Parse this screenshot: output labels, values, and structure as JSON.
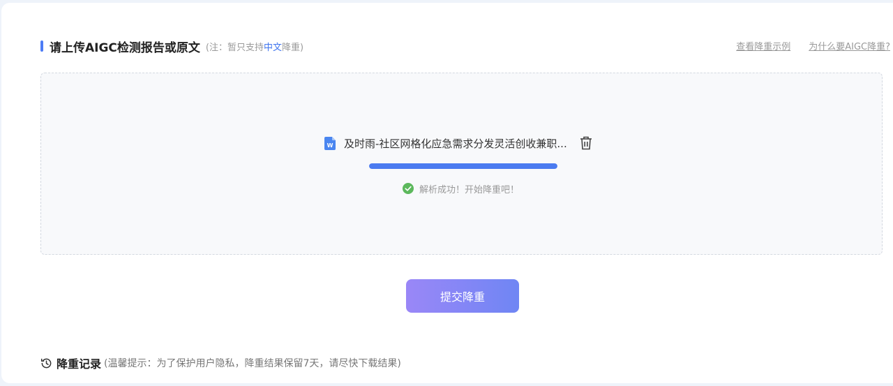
{
  "upload": {
    "title": "请上传AIGC检测报告或原文",
    "note_prefix": "(注：暂只支持",
    "note_highlight": "中文",
    "note_suffix": "降重)"
  },
  "links": {
    "example": "查看降重示例",
    "why": "为什么要AIGC降重?"
  },
  "file": {
    "icon": "word-doc-icon",
    "name": "及时雨-社区网格化应急需求分发灵活创收兼职...",
    "progress": 1.0,
    "status_text": "解析成功！开始降重吧！",
    "status_icon": "check-circle-icon"
  },
  "submit_label": "提交降重",
  "history": {
    "title": "降重记录",
    "tip": "(温馨提示：为了保护用户隐私，降重结果保留7天，请尽快下载结果)"
  },
  "colors": {
    "accent": "#4d7cf5",
    "highlight": "#3f74ee",
    "progress": "#4b7bf0",
    "success": "#5cb85c",
    "button_gradient_start": "#9a87f7",
    "button_gradient_end": "#6f86f4"
  }
}
